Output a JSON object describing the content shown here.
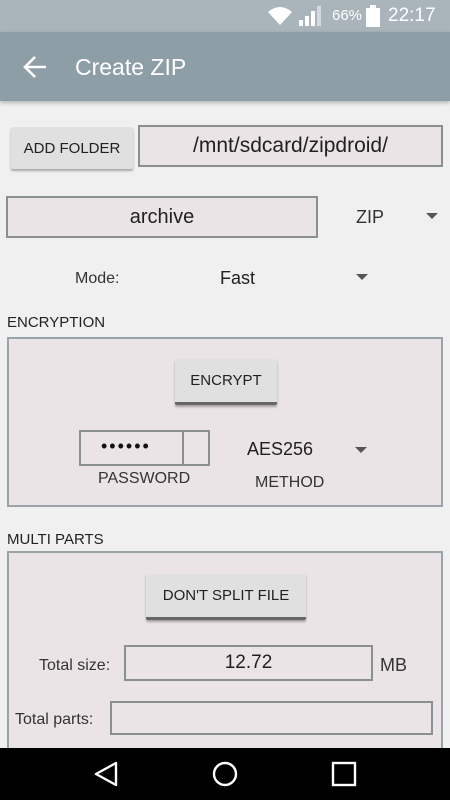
{
  "status_bar": {
    "battery_percent": "66%",
    "time": "22:17"
  },
  "app_bar": {
    "title": "Create ZIP"
  },
  "folder": {
    "add_label": "ADD FOLDER",
    "path": "/mnt/sdcard/zipdroid/"
  },
  "archive": {
    "name": "archive",
    "format": "ZIP"
  },
  "mode": {
    "label": "Mode:",
    "value": "Fast"
  },
  "encryption": {
    "section_label": "ENCRYPTION",
    "encrypt_label": "ENCRYPT",
    "password_mask": "••••••",
    "password_label": "PASSWORD",
    "method_value": "AES256",
    "method_label": "METHOD"
  },
  "multi_parts": {
    "section_label": "MULTI PARTS",
    "split_label": "DON'T SPLIT FILE",
    "total_size_label": "Total size:",
    "total_size_value": "12.72",
    "unit": "MB",
    "total_parts_label": "Total parts:",
    "total_parts_value": ""
  }
}
